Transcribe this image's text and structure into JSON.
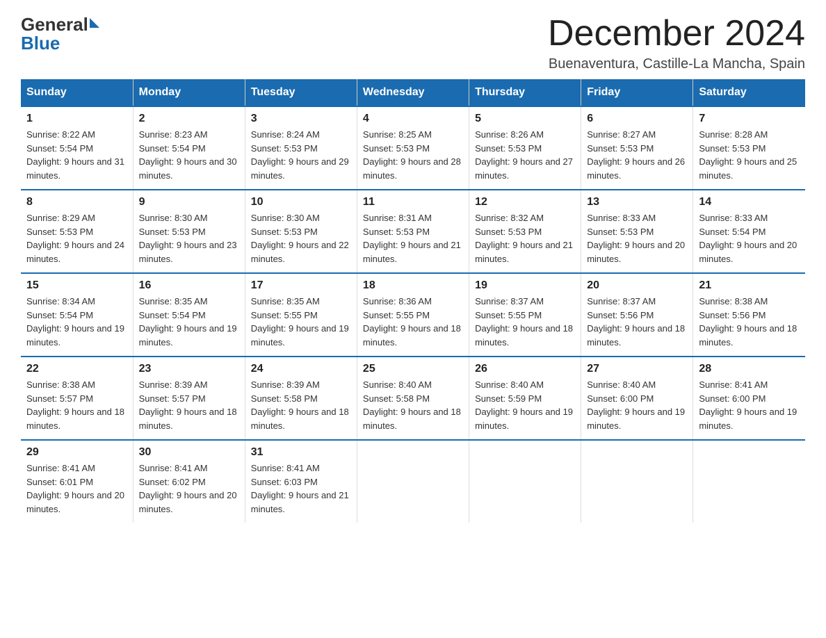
{
  "header": {
    "logo_general": "General",
    "logo_blue": "Blue",
    "title": "December 2024",
    "subtitle": "Buenaventura, Castille-La Mancha, Spain"
  },
  "days_of_week": [
    "Sunday",
    "Monday",
    "Tuesday",
    "Wednesday",
    "Thursday",
    "Friday",
    "Saturday"
  ],
  "weeks": [
    [
      {
        "day": "1",
        "sunrise": "8:22 AM",
        "sunset": "5:54 PM",
        "daylight": "9 hours and 31 minutes."
      },
      {
        "day": "2",
        "sunrise": "8:23 AM",
        "sunset": "5:54 PM",
        "daylight": "9 hours and 30 minutes."
      },
      {
        "day": "3",
        "sunrise": "8:24 AM",
        "sunset": "5:53 PM",
        "daylight": "9 hours and 29 minutes."
      },
      {
        "day": "4",
        "sunrise": "8:25 AM",
        "sunset": "5:53 PM",
        "daylight": "9 hours and 28 minutes."
      },
      {
        "day": "5",
        "sunrise": "8:26 AM",
        "sunset": "5:53 PM",
        "daylight": "9 hours and 27 minutes."
      },
      {
        "day": "6",
        "sunrise": "8:27 AM",
        "sunset": "5:53 PM",
        "daylight": "9 hours and 26 minutes."
      },
      {
        "day": "7",
        "sunrise": "8:28 AM",
        "sunset": "5:53 PM",
        "daylight": "9 hours and 25 minutes."
      }
    ],
    [
      {
        "day": "8",
        "sunrise": "8:29 AM",
        "sunset": "5:53 PM",
        "daylight": "9 hours and 24 minutes."
      },
      {
        "day": "9",
        "sunrise": "8:30 AM",
        "sunset": "5:53 PM",
        "daylight": "9 hours and 23 minutes."
      },
      {
        "day": "10",
        "sunrise": "8:30 AM",
        "sunset": "5:53 PM",
        "daylight": "9 hours and 22 minutes."
      },
      {
        "day": "11",
        "sunrise": "8:31 AM",
        "sunset": "5:53 PM",
        "daylight": "9 hours and 21 minutes."
      },
      {
        "day": "12",
        "sunrise": "8:32 AM",
        "sunset": "5:53 PM",
        "daylight": "9 hours and 21 minutes."
      },
      {
        "day": "13",
        "sunrise": "8:33 AM",
        "sunset": "5:53 PM",
        "daylight": "9 hours and 20 minutes."
      },
      {
        "day": "14",
        "sunrise": "8:33 AM",
        "sunset": "5:54 PM",
        "daylight": "9 hours and 20 minutes."
      }
    ],
    [
      {
        "day": "15",
        "sunrise": "8:34 AM",
        "sunset": "5:54 PM",
        "daylight": "9 hours and 19 minutes."
      },
      {
        "day": "16",
        "sunrise": "8:35 AM",
        "sunset": "5:54 PM",
        "daylight": "9 hours and 19 minutes."
      },
      {
        "day": "17",
        "sunrise": "8:35 AM",
        "sunset": "5:55 PM",
        "daylight": "9 hours and 19 minutes."
      },
      {
        "day": "18",
        "sunrise": "8:36 AM",
        "sunset": "5:55 PM",
        "daylight": "9 hours and 18 minutes."
      },
      {
        "day": "19",
        "sunrise": "8:37 AM",
        "sunset": "5:55 PM",
        "daylight": "9 hours and 18 minutes."
      },
      {
        "day": "20",
        "sunrise": "8:37 AM",
        "sunset": "5:56 PM",
        "daylight": "9 hours and 18 minutes."
      },
      {
        "day": "21",
        "sunrise": "8:38 AM",
        "sunset": "5:56 PM",
        "daylight": "9 hours and 18 minutes."
      }
    ],
    [
      {
        "day": "22",
        "sunrise": "8:38 AM",
        "sunset": "5:57 PM",
        "daylight": "9 hours and 18 minutes."
      },
      {
        "day": "23",
        "sunrise": "8:39 AM",
        "sunset": "5:57 PM",
        "daylight": "9 hours and 18 minutes."
      },
      {
        "day": "24",
        "sunrise": "8:39 AM",
        "sunset": "5:58 PM",
        "daylight": "9 hours and 18 minutes."
      },
      {
        "day": "25",
        "sunrise": "8:40 AM",
        "sunset": "5:58 PM",
        "daylight": "9 hours and 18 minutes."
      },
      {
        "day": "26",
        "sunrise": "8:40 AM",
        "sunset": "5:59 PM",
        "daylight": "9 hours and 19 minutes."
      },
      {
        "day": "27",
        "sunrise": "8:40 AM",
        "sunset": "6:00 PM",
        "daylight": "9 hours and 19 minutes."
      },
      {
        "day": "28",
        "sunrise": "8:41 AM",
        "sunset": "6:00 PM",
        "daylight": "9 hours and 19 minutes."
      }
    ],
    [
      {
        "day": "29",
        "sunrise": "8:41 AM",
        "sunset": "6:01 PM",
        "daylight": "9 hours and 20 minutes."
      },
      {
        "day": "30",
        "sunrise": "8:41 AM",
        "sunset": "6:02 PM",
        "daylight": "9 hours and 20 minutes."
      },
      {
        "day": "31",
        "sunrise": "8:41 AM",
        "sunset": "6:03 PM",
        "daylight": "9 hours and 21 minutes."
      },
      null,
      null,
      null,
      null
    ]
  ]
}
